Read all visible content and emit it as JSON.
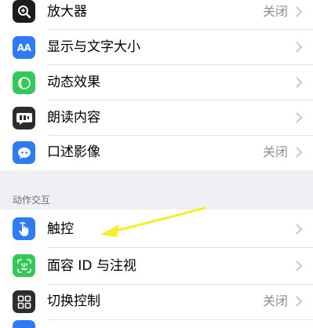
{
  "colors": {
    "group_bg": "#efeff4",
    "secondary_text": "#8e8e93",
    "chevron": "#c7c7cc",
    "arrow_annotation": "#f5ee2c"
  },
  "group1": {
    "items": [
      {
        "label": "放大器",
        "value": "关闭",
        "icon": "magnifier-icon",
        "icon_bg": "#1c1c1e"
      },
      {
        "label": "显示与文字大小",
        "value": "",
        "icon": "text-size-icon",
        "icon_bg": "#2f7bf6"
      },
      {
        "label": "动态效果",
        "value": "",
        "icon": "motion-icon",
        "icon_bg": "#34c759"
      },
      {
        "label": "朗读内容",
        "value": "",
        "icon": "speech-icon",
        "icon_bg": "#2c2c2e"
      },
      {
        "label": "口述影像",
        "value": "关闭",
        "icon": "audio-description-icon",
        "icon_bg": "#2f7bf6"
      }
    ]
  },
  "section2": {
    "header": "动作交互",
    "items": [
      {
        "label": "触控",
        "value": "",
        "icon": "touch-hand-icon",
        "icon_bg": "#2f7bf6"
      },
      {
        "label": "面容 ID 与注视",
        "value": "",
        "icon": "face-id-icon",
        "icon_bg": "#34c759"
      },
      {
        "label": "切换控制",
        "value": "关闭",
        "icon": "switch-control-icon",
        "icon_bg": "#2c2c2e"
      }
    ]
  }
}
